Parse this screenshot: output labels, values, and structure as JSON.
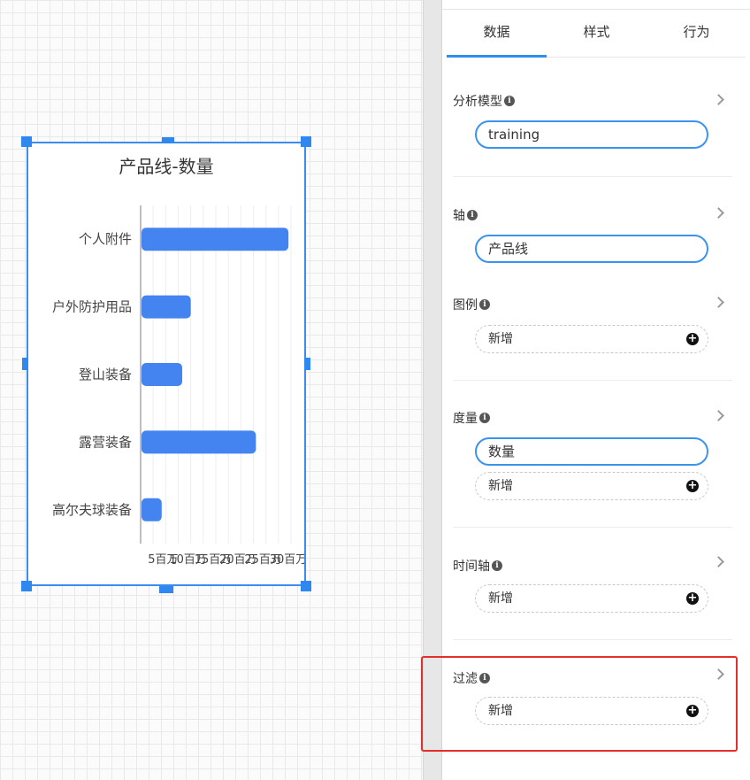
{
  "tabs": [
    {
      "label": "数据"
    },
    {
      "label": "样式"
    },
    {
      "label": "行为"
    }
  ],
  "sections": {
    "model": {
      "title": "分析模型",
      "value": "training"
    },
    "axis": {
      "title": "轴",
      "value": "产品线"
    },
    "legend": {
      "title": "图例",
      "add_label": "新增"
    },
    "measure": {
      "title": "度量",
      "value": "数量",
      "add_label": "新增"
    },
    "timeline": {
      "title": "时间轴",
      "add_label": "新增"
    },
    "filter": {
      "title": "过滤",
      "add_label": "新增"
    }
  },
  "icons": {
    "info": "info-icon",
    "chevron": "chevron-right-icon",
    "add": "plus-circle-icon"
  },
  "colors": {
    "accent": "#2f8ff0",
    "bar": "#4384f0",
    "highlight": "#e5302a"
  },
  "chart_data": {
    "type": "bar",
    "orientation": "horizontal",
    "title": "产品线-数量",
    "categories": [
      "个人附件",
      "户外防护用品",
      "登山装备",
      "露营装备",
      "高尔夫球装备"
    ],
    "values": [
      29.5,
      10.0,
      8.3,
      23.0,
      4.2
    ],
    "xlim": [
      0,
      30
    ],
    "x_ticks": [
      "5百万",
      "10百万",
      "15百万",
      "20百万",
      "25百万",
      "30百万"
    ],
    "x_tick_values": [
      5,
      10,
      15,
      20,
      25,
      30
    ],
    "grid": true
  }
}
